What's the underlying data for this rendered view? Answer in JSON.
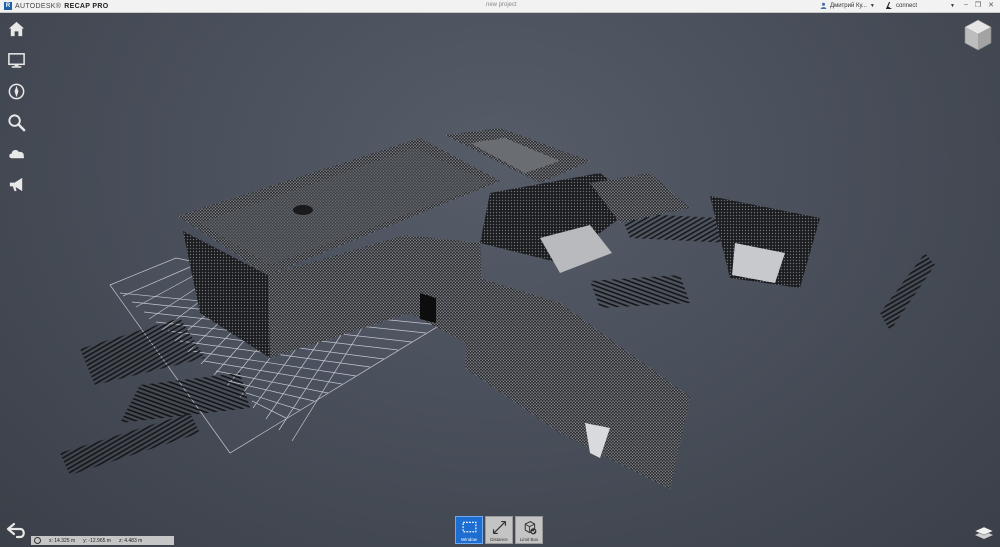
{
  "titlebar": {
    "logo_letter": "R",
    "vendor": "AUTODESK®",
    "product": "RECAP PRO",
    "project_name": "new project",
    "user_name": "Дмитрий Ку...",
    "connect_label": "connect",
    "window_controls": [
      "minimize",
      "restore",
      "close"
    ]
  },
  "left_toolbar": {
    "icons": [
      "home-icon",
      "monitor-icon",
      "compass-icon",
      "search-icon",
      "cloud-icon",
      "megaphone-icon"
    ]
  },
  "status": {
    "x_label": "x:",
    "x_value": "14.325",
    "x_unit": "m",
    "y_label": "y:",
    "y_value": "-12.965",
    "y_unit": "m",
    "z_label": "z:",
    "z_value": "4.483",
    "z_unit": "m"
  },
  "bottom_toolbar": {
    "buttons": [
      {
        "label": "Window",
        "icon": "window-select-icon",
        "active": true
      },
      {
        "label": "Distance",
        "icon": "distance-icon",
        "active": false
      },
      {
        "label": "Limit Box",
        "icon": "limit-box-icon",
        "active": false
      }
    ]
  },
  "colors": {
    "background_center": "#565c68",
    "background_edge": "#3a3f48",
    "active_tool": "#1e6dd0",
    "brand_blue": "#1f5fa8"
  }
}
